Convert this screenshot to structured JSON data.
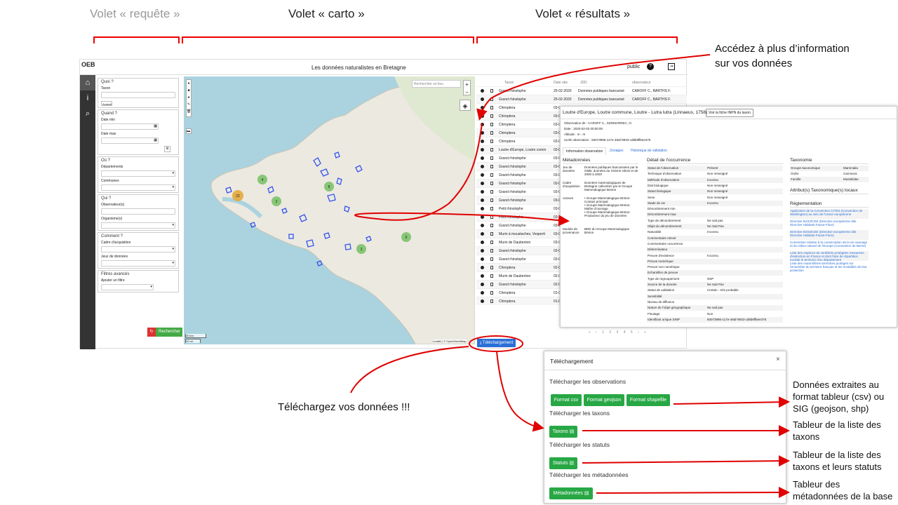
{
  "labels": {
    "requete": "Volet « requête »",
    "carto": "Volet « carto »",
    "resultats": "Volet « résultats »"
  },
  "annotations": {
    "plus_info": [
      "Accédez à plus d’information",
      "sur vos données"
    ],
    "telechargez": "Téléchargez vos données !!!",
    "obs": [
      "Données extraites au",
      "format tableur (csv) ou",
      "SIG (geojson, shp)"
    ],
    "taxons": [
      "Tableur de la liste des",
      "taxons"
    ],
    "statuts": [
      "Tableur de la liste des",
      "taxons et leurs statuts"
    ],
    "meta": [
      "Tableur des",
      "métadonnées de la base"
    ]
  },
  "app": {
    "logo": "OEB",
    "title": "Les données naturalistes en Bretagne",
    "public": "public",
    "help": "?",
    "logout": "⇥",
    "nav": [
      "⌂",
      "i",
      "⌕"
    ],
    "query": {
      "quoi": "Quoi ?",
      "taxon": "Taxon",
      "avance": "Avancé",
      "quand": "Quand ?",
      "date_min": "Date min",
      "date_max": "Date max",
      "ou": "Où ?",
      "departements": "Départements",
      "communes": "Communes",
      "qui": "Qui ?",
      "observateurs": "Observateur(s)",
      "organismes": "Organisme(s)",
      "comment": "Comment ?",
      "cadre": "Cadre d'acquisition",
      "jeux": "Jeux de données",
      "filtres": "Filtres avancés",
      "ajouter": "Ajouter un filtre",
      "rechercher": "Rechercher"
    },
    "map": {
      "search_placeholder": "Rechercher un lieu",
      "zoom_in": "+",
      "zoom_out": "−",
      "scale_km": "30 km",
      "scale_mi": "20 mi",
      "attribution": "Leaflet | © OpenStreetMap",
      "clusters": [
        "4",
        "8",
        "22",
        "2",
        "3",
        "6"
      ]
    },
    "results": {
      "headers": [
        "Taxon",
        "Date obs",
        "JDD",
        "observateur"
      ],
      "rows": [
        [
          "Grand rhinolophe",
          "25-02-2020",
          "Données publiques bancarisé",
          "CAROFF C., BARTHS F."
        ],
        [
          "Grand rhinolophe",
          "25-02-2020",
          "Données publiques bancarisé",
          "CAROFF C., BARTHS F."
        ],
        [
          "Chiroptera",
          "03-02",
          "",
          ""
        ],
        [
          "Chiroptera",
          "03-02",
          "",
          ""
        ],
        [
          "Chiroptera",
          "03-02",
          "",
          ""
        ],
        [
          "Chiroptera",
          "03-02",
          "",
          ""
        ],
        [
          "Chiroptera",
          "03-02",
          "",
          ""
        ],
        [
          "Loutre d'Europe, Loutre comm",
          "03-02",
          "",
          ""
        ],
        [
          "Grand rhinolophe",
          "03-02",
          "",
          ""
        ],
        [
          "Grand rhinolophe",
          "03-02",
          "",
          ""
        ],
        [
          "Grand rhinolophe",
          "03-02",
          "",
          ""
        ],
        [
          "Grand rhinolophe",
          "03-02",
          "",
          ""
        ],
        [
          "Grand rhinolophe",
          "03-02",
          "",
          ""
        ],
        [
          "Grand rhinolophe",
          "03-02",
          "",
          ""
        ],
        [
          "Petit rhinolophe",
          "03-02",
          "",
          ""
        ],
        [
          "Petit rhinolophe",
          "03-02",
          "",
          ""
        ],
        [
          "Grand rhinolophe",
          "03-02",
          "",
          ""
        ],
        [
          "Murin à moustaches, Vesperti",
          "03-02",
          "",
          ""
        ],
        [
          "Murin de Daubenton",
          "03-02",
          "",
          ""
        ],
        [
          "Grand rhinolophe",
          "03-02",
          "",
          ""
        ],
        [
          "Grand rhinolophe",
          "03-02",
          "",
          ""
        ],
        [
          "Chiroptera",
          "02-02",
          "",
          ""
        ],
        [
          "Murin de Daubenton",
          "02-02",
          "",
          ""
        ],
        [
          "Grand rhinolophe",
          "02-02",
          "",
          ""
        ],
        [
          "Chiroptera",
          "01-02",
          "",
          ""
        ],
        [
          "Chiroptera",
          "01-02",
          "",
          ""
        ]
      ],
      "download": "Téléchargement",
      "pager": [
        "1",
        "2",
        "3",
        "4",
        "5"
      ]
    }
  },
  "detail": {
    "title": "Loutre d'Europe, Loutre commune, Loutre - Lutra lutra (Linnaeus, 1758)",
    "inpn": "Voir la fiche INPN du taxon",
    "meta_lines": [
      "Observation de : CAROFF C., KERMARREC, O.",
      "Date : 2020-02-03 00:00:00",
      "Altitude : m - m",
      "UUID observation : 60073996-117e-48af-9933-cd8b9ff5ee376"
    ],
    "tabs": [
      "Information observation",
      "Zonages",
      "Historique de validation"
    ],
    "metadonnees": "Métadonnées",
    "detail_occ": "Détail de l'occurrence",
    "taxonomie": "Taxonomie",
    "attributs": "Attribut(s) Taxonomique(s) locaux",
    "reglementation": "Réglementation",
    "meta_rows": [
      [
        "Jeu de données",
        "Données publiques bancarisées par le GMB, données du XXème siècle et de 2000 à 2020"
      ],
      [
        "Cadre d'acquisition",
        "Données mammalogiques de Bretagne collectées par le Groupe Mammalogique Breton"
      ],
      [
        "Acteurs",
        "• Groupe Mammalogique Breton: Contact principal"
      ],
      [
        "",
        "• Groupe Mammalogique Breton: Maître d'ouvrage"
      ],
      [
        "",
        "• Groupe Mammalogique Breton: Producteur du jeu de données"
      ],
      [
        "Module de provenance",
        "BDD du Groupe Mammalogique Breton"
      ]
    ],
    "occ_rows": [
      [
        "Statut de l'observation",
        "Présent"
      ],
      [
        "Technique d'observation",
        "Non renseigné"
      ],
      [
        "Méthode d'observation",
        "Inconnu"
      ],
      [
        "Etat biologique",
        "Non renseigné"
      ],
      [
        "Statut biologique",
        "Non renseigné"
      ],
      [
        "Sexe",
        "Non renseigné"
      ],
      [
        "Stade de vie",
        "Inconnu"
      ],
      [
        "Dénombrement min",
        ""
      ],
      [
        "Dénombrement max",
        ""
      ],
      [
        "Type de dénombrement",
        "Ne sait pas"
      ],
      [
        "Objet du dénombrement",
        "Ne Sait Pas"
      ],
      [
        "Naturalité",
        "Inconnu"
      ],
      [
        "Commentaire relevé",
        ""
      ],
      [
        "Commentaire occurrence",
        ""
      ],
      [
        "Déterminateur",
        ""
      ],
      [
        "Preuve d'existence",
        "Inconnu"
      ],
      [
        "Preuve numérique",
        ""
      ],
      [
        "Preuve non numérique",
        ""
      ],
      [
        "Echantillon de preuve",
        ""
      ],
      [
        "Type de regroupement",
        "NSP"
      ],
      [
        "Source de la donnée",
        "Ne Sait Pas"
      ],
      [
        "Statut de validation",
        "Certain - très probable"
      ],
      [
        "Sensibilité",
        ""
      ],
      [
        "Niveau de diffusion",
        ""
      ],
      [
        "Nature de l'objet géographique",
        "Ne sait pas"
      ],
      [
        "Floutage",
        "Non"
      ],
      [
        "Identifiant unique SINP",
        "60073996-117e-48af-9933-cd8b9ff5ee376"
      ]
    ],
    "taxo_rows": [
      [
        "Groupe taxonomique",
        "Mammalia"
      ],
      [
        "Ordre",
        "Carnivora"
      ],
      [
        "Famille",
        "Mustelidae"
      ]
    ],
    "regl": [
      "Application de la Convention CITES (Convention de Washington) au sein de l'Union européenne",
      "Directive 92/43/CEE (Directive européenne dite Directive Habitats-Faune-Flore)",
      "Directive 92/43/CEE (Directive européenne dite Directive Habitats-Faune-Flore)",
      "Convention relative à la conservation de la vie sauvage et du milieu naturel de l'Europe (Convention de Berne)",
      "Liste des espèces de vertébrés protégées menacées d'extinction en France et dont l'aire de répartition excède le territoire d'un département",
      "Liste des mammifères terrestres protégés sur l'ensemble du territoire français et les modalités de leur protection"
    ]
  },
  "modal": {
    "title": "Téléchargement",
    "close": "×",
    "h_obs": "Télécharger les observations",
    "csv": "Format csv",
    "geojson": "Format geojson",
    "shapefile": "Format shapefile",
    "h_taxons": "Télécharger les taxons",
    "taxons": "Taxons ▤",
    "h_statuts": "Télécharger les statuts",
    "statuts": "Statuts ▤",
    "h_meta": "Télécharger les métadonnées",
    "meta": "Métadonnées ▤"
  },
  "colors": {
    "annotation_red": "#e00000",
    "green": "#28a745",
    "blue": "#2a6fd6"
  }
}
